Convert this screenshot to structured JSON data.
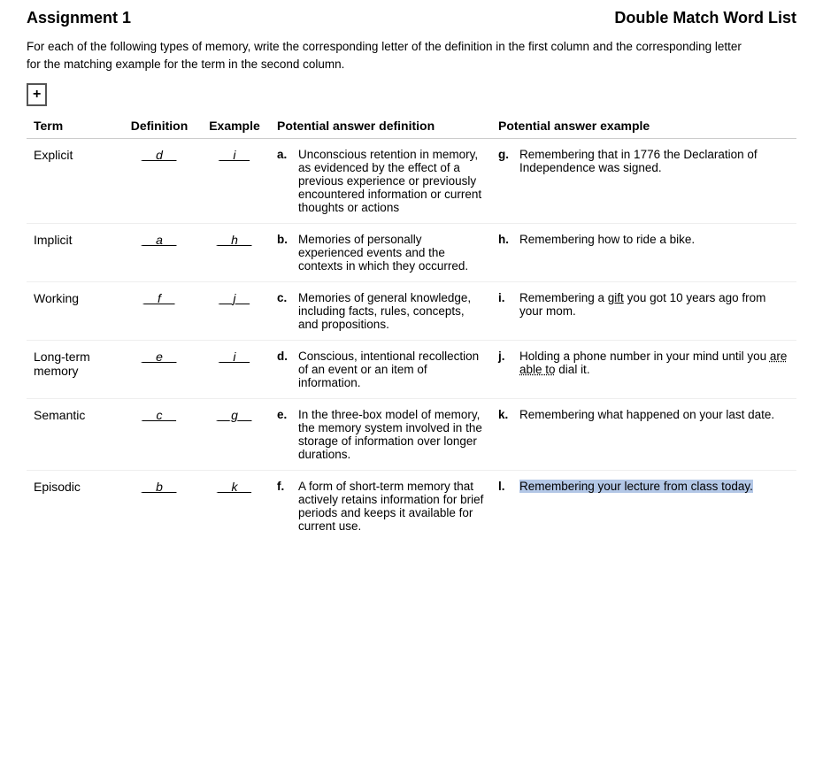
{
  "header": {
    "left": "Assignment 1",
    "right": "Double Match Word List"
  },
  "instructions": "For each of the following types of memory, write the corresponding letter of the definition in the first column and the corresponding letter for the matching example for the term in the second column.",
  "columns": {
    "term": "Term",
    "definition": "Definition",
    "example": "Example",
    "pot_def": "Potential answer definition",
    "pot_ex": "Potential answer example"
  },
  "rows": [
    {
      "term": "Explicit",
      "definition": "__d__",
      "example": "__i__"
    },
    {
      "term": "Implicit",
      "definition": "__a__",
      "example": "__h__"
    },
    {
      "term": "Working",
      "definition": "__f__",
      "example": "__j__"
    },
    {
      "term": "Long-term memory",
      "definition": "__e__",
      "example": "__i__"
    },
    {
      "term": "Semantic",
      "definition": "__c__",
      "example": "__g__"
    },
    {
      "term": "Episodic",
      "definition": "__b__",
      "example": "__k__"
    }
  ],
  "potential_definitions": [
    {
      "letter": "a.",
      "text": "Unconscious retention in memory, as evidenced by the effect of a previous experience or previously encountered information or current thoughts or actions"
    },
    {
      "letter": "b.",
      "text": "Memories of personally experienced events and the contexts in which they occurred."
    },
    {
      "letter": "c.",
      "text": "Memories of general knowledge, including facts, rules, concepts, and propositions."
    },
    {
      "letter": "d.",
      "text": "Conscious, intentional recollection of an event or an item of information."
    },
    {
      "letter": "e.",
      "text": "In the three-box model of memory, the memory system involved in the storage of information over longer durations."
    },
    {
      "letter": "f.",
      "text": "A form of short-term memory that actively retains information for brief periods and keeps it available for current use."
    }
  ],
  "potential_examples": [
    {
      "letter": "g.",
      "text": "Remembering that in 1776 the Declaration of Independence was signed."
    },
    {
      "letter": "h.",
      "text": "Remembering how to ride a bike."
    },
    {
      "letter": "i.",
      "text": "Remembering a gift you got 10 years ago from your mom.",
      "has_underline_word": true,
      "underline_word": "gift"
    },
    {
      "letter": "j.",
      "text_parts": [
        "Holding a phone number in your mind until you ",
        "are able to",
        " dial it."
      ],
      "has_dotted_underline": true
    },
    {
      "letter": "k.",
      "text": "Remembering what happened on your last date."
    },
    {
      "letter": "l.",
      "text": "Remembering your lecture from class today.",
      "highlighted": true
    }
  ],
  "add_button_label": "+"
}
